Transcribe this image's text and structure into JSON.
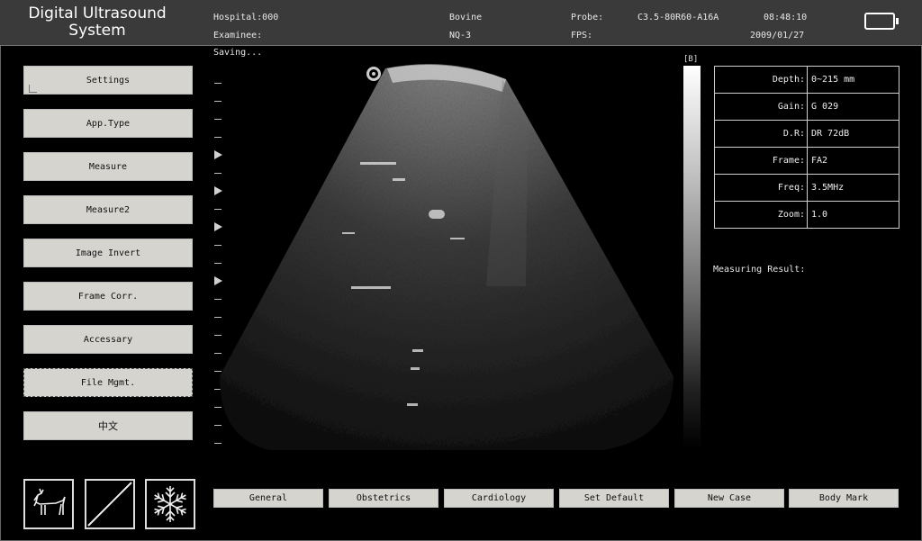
{
  "header": {
    "app_title": "Digital Ultrasound System",
    "hospital": "Hospital:000",
    "examinee": "Examinee:",
    "species": "Bovine",
    "nq": "NQ-3",
    "probe_label": "Probe:",
    "probe_value": "C3.5-80R60-A16A",
    "fps_label": "FPS:",
    "time": "08:48:10",
    "date": "2009/01/27",
    "battery_icon": "battery-icon"
  },
  "status": "Saving...",
  "sidebar": {
    "items": [
      {
        "label": "Settings"
      },
      {
        "label": "App.Type"
      },
      {
        "label": "Measure"
      },
      {
        "label": "Measure2"
      },
      {
        "label": "Image Invert"
      },
      {
        "label": "Frame Corr."
      },
      {
        "label": "Accessary"
      },
      {
        "label": "File Mgmt."
      },
      {
        "label": "中文"
      }
    ]
  },
  "mode_icons": [
    "goat-icon",
    "diagonal-line-icon",
    "snowflake-icon"
  ],
  "grayscale_label": "[B]",
  "params": [
    {
      "key": "Depth:",
      "value": "0~215 mm"
    },
    {
      "key": "Gain:",
      "value": "G 029"
    },
    {
      "key": "D.R:",
      "value": "DR 72dB"
    },
    {
      "key": "Frame:",
      "value": "FA2"
    },
    {
      "key": "Freq:",
      "value": "3.5MHz"
    },
    {
      "key": "Zoom:",
      "value": "1.0"
    }
  ],
  "measuring_result_label": "Measuring Result:",
  "bottom_buttons": [
    {
      "label": "General"
    },
    {
      "label": "Obstetrics"
    },
    {
      "label": "Cardiology"
    },
    {
      "label": "Set Default"
    },
    {
      "label": "New Case"
    },
    {
      "label": "Body Mark"
    }
  ]
}
